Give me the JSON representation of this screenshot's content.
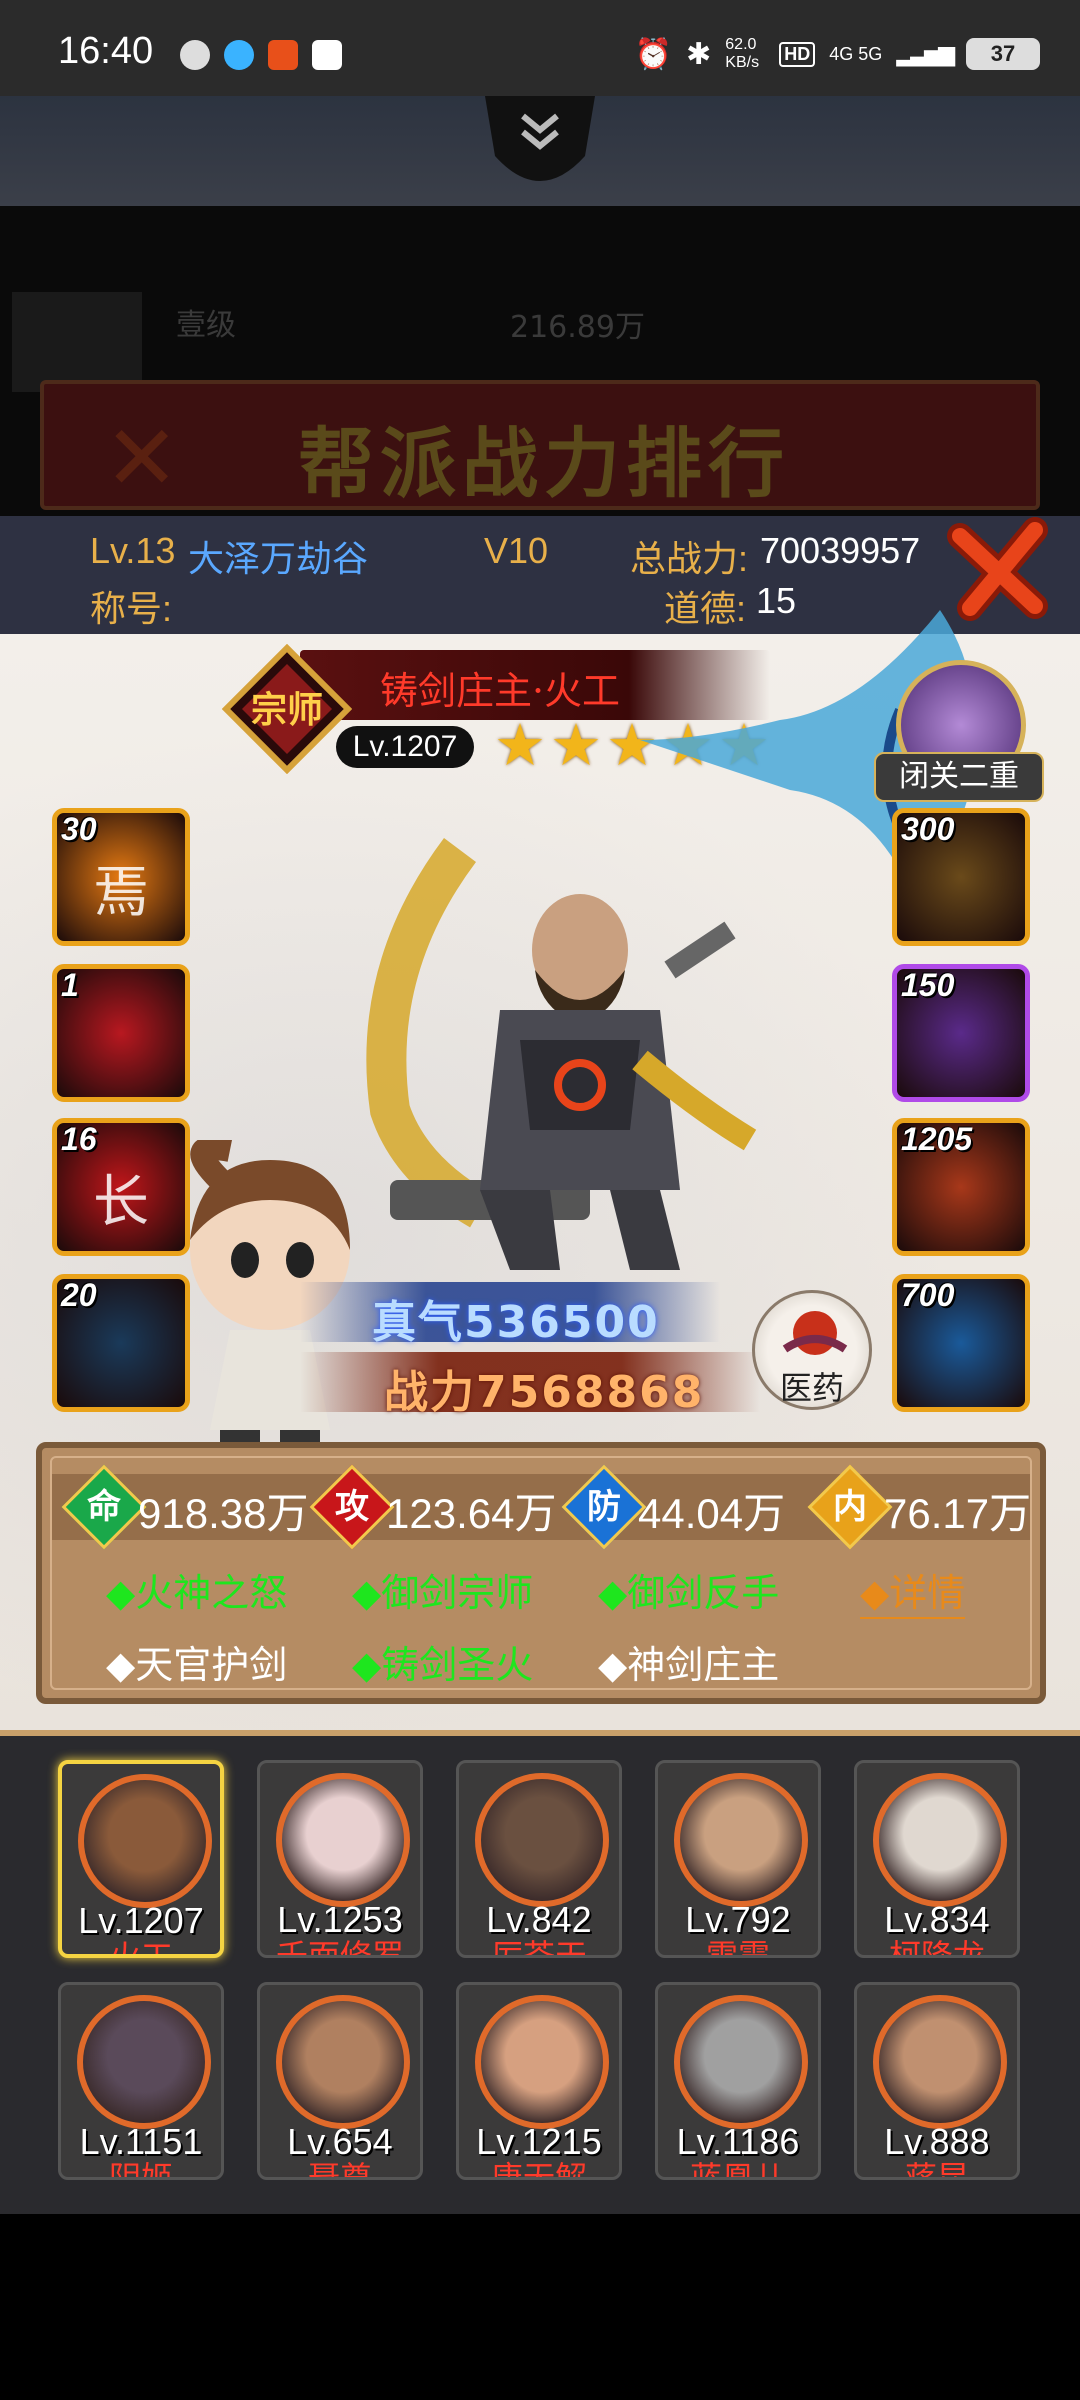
{
  "status_bar": {
    "time": "16:40",
    "net_speed": "62.0 KB/s",
    "network": "4G 5G",
    "battery": "37"
  },
  "background": {
    "banner_title": "帮派战力排行",
    "row_level_text": "壹级",
    "row_power_text": "216.89万"
  },
  "player_info": {
    "level_prefix": "Lv.13",
    "guild_name": "大泽万劫谷",
    "vip": "V10",
    "total_power_label": "总战力:",
    "total_power": "70039957",
    "title_label": "称号:",
    "morality_label": "道德:",
    "morality": "15"
  },
  "hero": {
    "rank_badge": "宗师",
    "name": "铸剑庄主·火工",
    "level": "Lv.1207",
    "stars": 5,
    "pet_status": "闭关二重",
    "zhenqi_label": "真气",
    "zhenqi": "536500",
    "power_label": "战力",
    "power": "7568868",
    "medicine_label": "医药"
  },
  "left_slots": [
    {
      "num": "30",
      "glyph": "焉",
      "color": "#e67a12"
    },
    {
      "num": "1",
      "glyph": "",
      "color": "#b81820"
    },
    {
      "num": "16",
      "glyph": "长",
      "color": "#c0161a"
    },
    {
      "num": "20",
      "glyph": "",
      "color": "#1a3a5a"
    }
  ],
  "right_slots": [
    {
      "num": "300",
      "glyph": "",
      "color": "#6a4a1a"
    },
    {
      "num": "150",
      "glyph": "",
      "color": "#5a2a8a"
    },
    {
      "num": "1205",
      "glyph": "",
      "color": "#a8381a"
    },
    {
      "num": "700",
      "glyph": "",
      "color": "#1a5a9a"
    }
  ],
  "stats": [
    {
      "icon": "命",
      "value": "918.38万",
      "color": "#1aa84a"
    },
    {
      "icon": "攻",
      "value": "123.64万",
      "color": "#c8161a"
    },
    {
      "icon": "防",
      "value": "44.04万",
      "color": "#1a72d6"
    },
    {
      "icon": "内",
      "value": "76.17万",
      "color": "#e8a21a"
    }
  ],
  "passives": {
    "row1": [
      "◆火神之怒",
      "◆御剑宗师",
      "◆御剑反手"
    ],
    "details": "◆详情",
    "row2": [
      "◆天官护剑",
      "◆铸剑圣火",
      "◆神剑庄主"
    ]
  },
  "heroes": [
    {
      "level": "Lv.1207",
      "name": "火工"
    },
    {
      "level": "Lv.1253",
      "name": "千面修罗"
    },
    {
      "level": "Lv.842",
      "name": "厉苍天"
    },
    {
      "level": "Lv.792",
      "name": "雷震"
    },
    {
      "level": "Lv.834",
      "name": "柯降龙"
    },
    {
      "level": "Lv.1151",
      "name": "阴姬"
    },
    {
      "level": "Lv.654",
      "name": "聂尊"
    },
    {
      "level": "Lv.1215",
      "name": "唐无解"
    },
    {
      "level": "Lv.1186",
      "name": "蓝凰儿"
    },
    {
      "level": "Lv.888",
      "name": "蒋昆"
    }
  ]
}
